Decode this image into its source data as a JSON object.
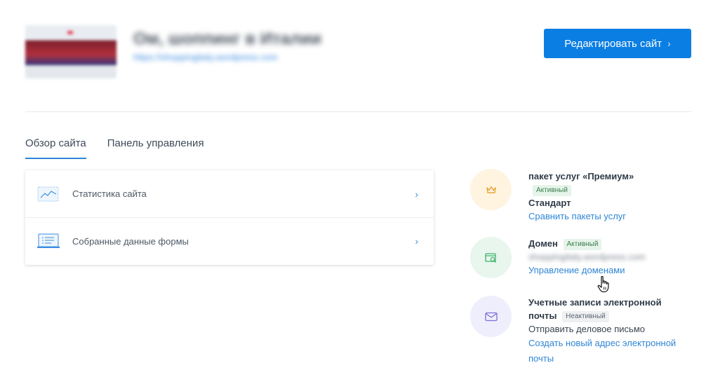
{
  "header": {
    "site_title": "Ом, шоппинг в Италии",
    "site_url": "https://shoppingitaly.wordpress.com",
    "edit_button_label": "Редактировать сайт",
    "edit_button_chevron": "›"
  },
  "tabs": [
    {
      "label": "Обзор сайта",
      "active": true
    },
    {
      "label": "Панель управления",
      "active": false
    }
  ],
  "overview": {
    "rows": [
      {
        "label": "Статистика сайта",
        "icon": "stats-chart-icon",
        "chevron": "›"
      },
      {
        "label": "Собранные данные формы",
        "icon": "form-data-icon",
        "chevron": "›"
      }
    ]
  },
  "plan": {
    "title": "пакет услуг «Премиум»",
    "badge": "Активный",
    "subtitle": "Стандарт",
    "link": "Сравнить пакеты услуг",
    "icon": "crown-icon",
    "color": "#fff4e0"
  },
  "domain": {
    "title": "Домен",
    "badge": "Активный",
    "value": "shoppingitaly.wordpress.com",
    "link": "Управление доменами",
    "icon": "domain-search-icon",
    "color": "#e8f6ee"
  },
  "email": {
    "title_line1": "Учетные записи электронной",
    "title_line2": "почты",
    "badge": "Неактивный",
    "subtitle": "Отправить деловое письмо",
    "link_line1": "Создать новый адрес электронной",
    "link_line2": "почты",
    "icon": "mail-icon",
    "color": "#efeefc"
  },
  "colors": {
    "accent": "#0b7ee3",
    "link": "#2f86d6",
    "active_badge_bg": "#e6f4ea",
    "inactive_badge_bg": "#eef0f2"
  }
}
